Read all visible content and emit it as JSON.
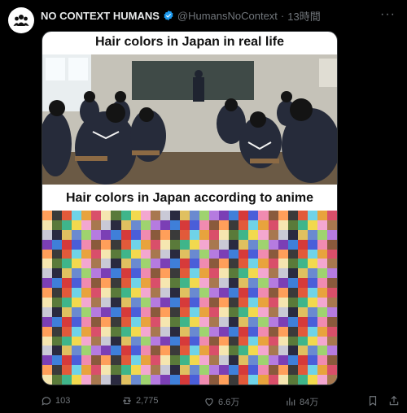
{
  "post": {
    "author_name": "NO CONTEXT HUMANS",
    "handle": "@HumansNoContext",
    "separator": "·",
    "time": "13時間",
    "verified_color": "#1d9bf0"
  },
  "media": {
    "title_top": "Hair colors in Japan in real life",
    "title_bottom": "Hair colors in Japan according to anime"
  },
  "actions": {
    "replies": "103",
    "reposts": "2,775",
    "likes": "6.6万",
    "views": "84万"
  },
  "colors": {
    "background": "#000000",
    "muted": "#71767b",
    "accent": "#1d9bf0"
  },
  "icons": [
    "people-group-icon",
    "verified-badge-icon",
    "more-icon",
    "reply-icon",
    "repost-icon",
    "like-icon",
    "views-icon",
    "bookmark-icon",
    "share-icon"
  ]
}
